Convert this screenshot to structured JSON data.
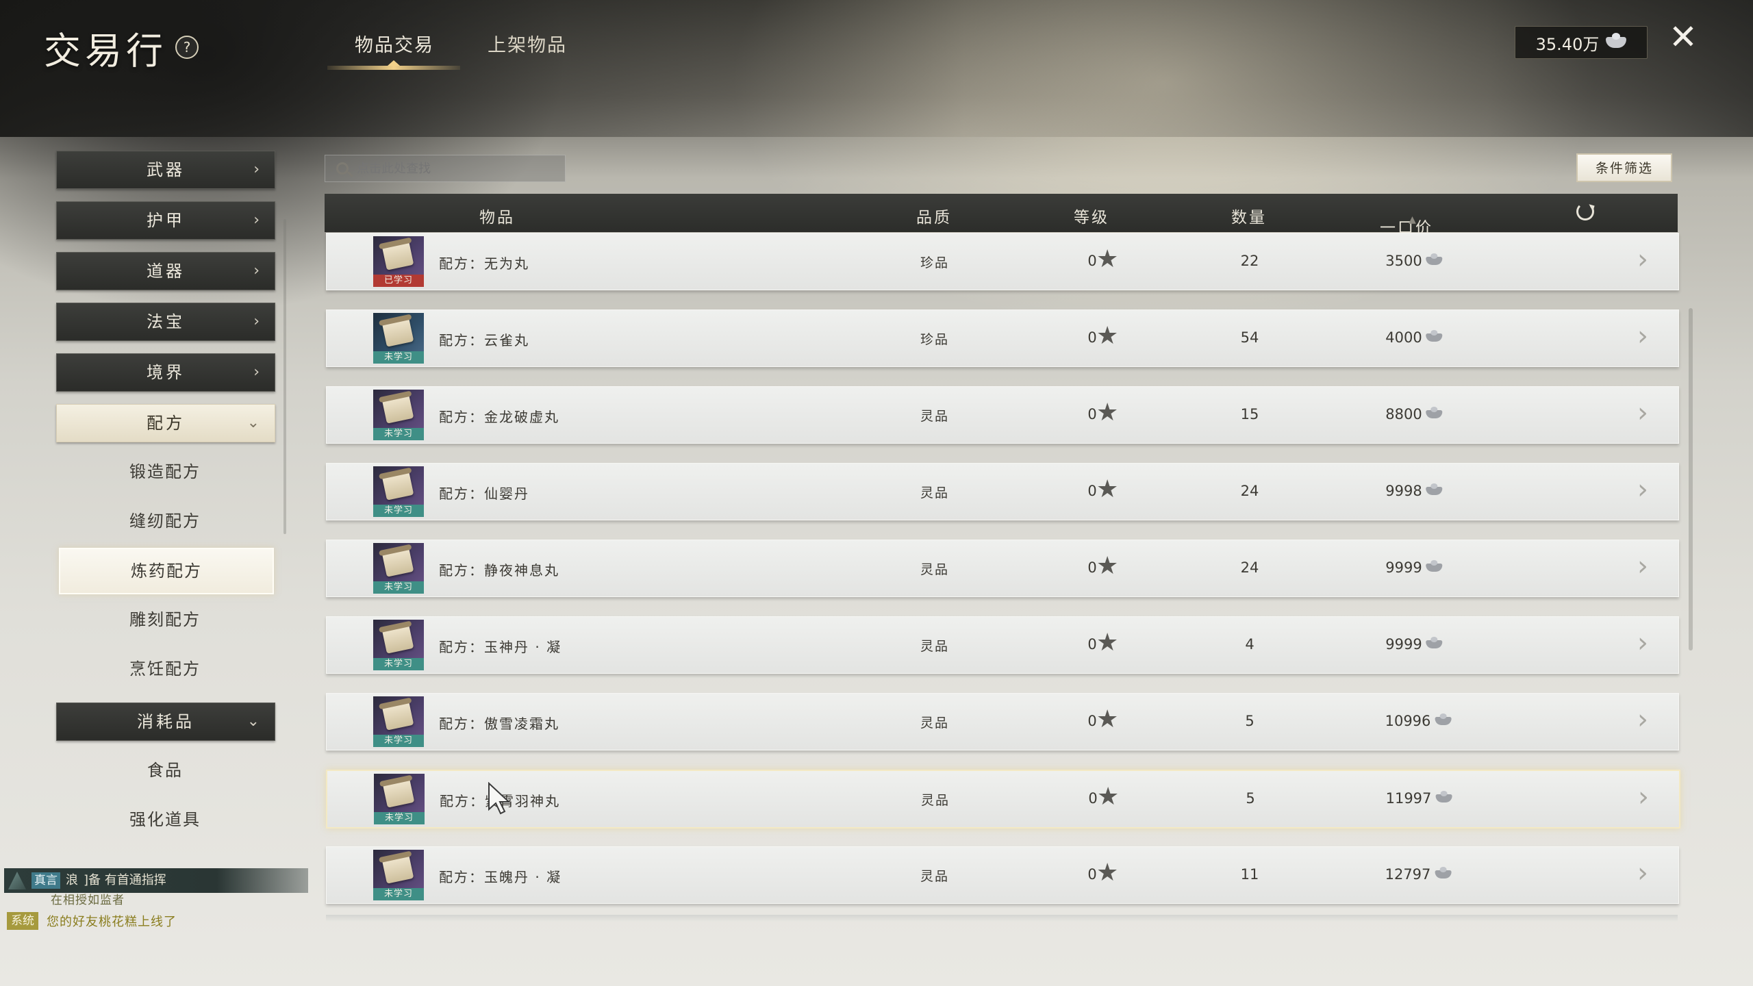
{
  "header": {
    "title": "交易行",
    "help_icon": "?",
    "tabs": [
      {
        "label": "物品交易",
        "active": true
      },
      {
        "label": "上架物品",
        "active": false
      }
    ],
    "currency": "35.40万",
    "close_icon": "✕"
  },
  "sidebar": {
    "categories": [
      {
        "label": "武器",
        "arrow": "›"
      },
      {
        "label": "护甲",
        "arrow": "›"
      },
      {
        "label": "道器",
        "arrow": "›"
      },
      {
        "label": "法宝",
        "arrow": "›"
      },
      {
        "label": "境界",
        "arrow": "›"
      }
    ],
    "expanded": {
      "label": "配方",
      "arrow": "⌄",
      "subs": [
        "锻造配方",
        "缝纫配方",
        "炼药配方",
        "雕刻配方",
        "烹饪配方"
      ],
      "selected": "炼药配方"
    },
    "consumables": {
      "label": "消耗品",
      "arrow": "⌄",
      "subs": [
        "食品",
        "强化道具"
      ]
    }
  },
  "search": {
    "placeholder": "点击此处查找"
  },
  "filter_button": "条件筛选",
  "table": {
    "columns": [
      "物品",
      "品质",
      "等级",
      "数量",
      "一口价"
    ],
    "sort_icon": "▲",
    "rows": [
      {
        "name": "配方：无为丸",
        "status": "已学习",
        "quality": "珍品",
        "level": "0",
        "qty": "22",
        "price": "3500"
      },
      {
        "name": "配方：云雀丸",
        "status": "未学习",
        "quality": "珍品",
        "level": "0",
        "qty": "54",
        "price": "4000"
      },
      {
        "name": "配方：金龙破虚丸",
        "status": "未学习",
        "quality": "灵品",
        "level": "0",
        "qty": "15",
        "price": "8800"
      },
      {
        "name": "配方：仙婴丹",
        "status": "未学习",
        "quality": "灵品",
        "level": "0",
        "qty": "24",
        "price": "9998"
      },
      {
        "name": "配方：静夜神息丸",
        "status": "未学习",
        "quality": "灵品",
        "level": "0",
        "qty": "24",
        "price": "9999"
      },
      {
        "name": "配方：玉神丹 · 凝",
        "status": "未学习",
        "quality": "灵品",
        "level": "0",
        "qty": "4",
        "price": "9999"
      },
      {
        "name": "配方：傲雪凌霜丸",
        "status": "未学习",
        "quality": "灵品",
        "level": "0",
        "qty": "5",
        "price": "10996"
      },
      {
        "name": "配方：紫霄羽神丸",
        "status": "未学习",
        "quality": "灵品",
        "level": "0",
        "qty": "5",
        "price": "11997"
      },
      {
        "name": "配方：玉魄丹 · 凝",
        "status": "未学习",
        "quality": "灵品",
        "level": "0",
        "qty": "11",
        "price": "12797"
      }
    ],
    "fav_icon": "★",
    "go_icon": "›"
  },
  "chat": {
    "line1": {
      "channel": "真言",
      "tag": "浪",
      "text": "]备  有首通指挥"
    },
    "line1_sub": "在相授如监者",
    "line2": {
      "channel": "系统",
      "text": "您的好友桃花糕上线了"
    }
  },
  "colors": {
    "header_dark": "#2b2c29",
    "accent_gold": "#f2d18a",
    "learned_red": "#b23a33",
    "unlearned_teal": "#3f8f86"
  }
}
